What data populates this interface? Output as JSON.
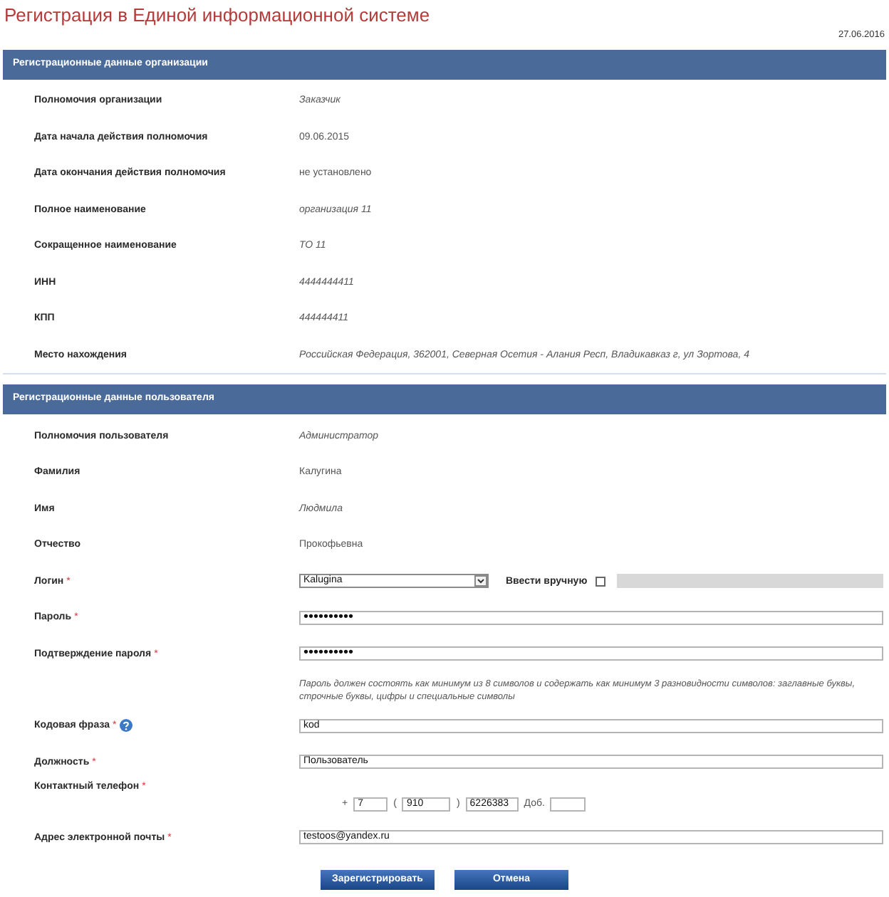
{
  "page": {
    "title": "Регистрация в Единой информационной системе",
    "date": "27.06.2016"
  },
  "sections": [
    {
      "title": "Регистрационные данные организации",
      "rows": [
        {
          "kind": "text",
          "label": "Полномочия организации",
          "value": "Заказчик",
          "italic": true
        },
        {
          "kind": "text",
          "label": "Дата начала действия полномочия",
          "value": "09.06.2015",
          "italic": false
        },
        {
          "kind": "text",
          "label": "Дата окончания действия полномочия",
          "value": "не установлено",
          "italic": false
        },
        {
          "kind": "text",
          "label": "Полное наименование",
          "value": "организация 11",
          "italic": true
        },
        {
          "kind": "text",
          "label": "Сокращенное наименование",
          "value": "ТО 11",
          "italic": true
        },
        {
          "kind": "text",
          "label": "ИНН",
          "value": "4444444411",
          "italic": true
        },
        {
          "kind": "text",
          "label": "КПП",
          "value": "444444411",
          "italic": true
        },
        {
          "kind": "text",
          "label": "Место нахождения",
          "value": "Российская Федерация, 362001, Северная Осетия - Алания Респ, Владикавказ г, ул Зортова, 4",
          "italic": true
        }
      ]
    },
    {
      "title": "Регистрационные данные пользователя",
      "rows": [
        {
          "kind": "text",
          "label": "Полномочия пользователя",
          "value": "Администратор",
          "italic": true
        },
        {
          "kind": "text",
          "label": "Фамилия",
          "value": "Калугина",
          "italic": false
        },
        {
          "kind": "text",
          "label": "Имя",
          "value": "Людмила",
          "italic": true
        },
        {
          "kind": "text",
          "label": "Отчество",
          "value": "Прокофьевна",
          "italic": false
        },
        {
          "kind": "login",
          "label": "Логин",
          "mark": "*",
          "value": "Kalugina",
          "manual_label": "Ввести вручную",
          "manual_checked": false
        },
        {
          "kind": "password",
          "label": "Пароль",
          "mark": "*",
          "value": "••••••••••"
        },
        {
          "kind": "password",
          "label": "Подтверждение пароля",
          "mark": "*",
          "value": "••••••••••"
        },
        {
          "kind": "hint",
          "text": "Пароль должен состоять как минимум из 8 символов и содержать как минимум 3 разновидности символов: заглавные буквы, строчные буквы, цифры и специальные символы"
        },
        {
          "kind": "input",
          "label": "Кодовая фраза",
          "mark": "*",
          "help": true,
          "value": "kod"
        },
        {
          "kind": "input",
          "label": "Должность",
          "mark": "*",
          "value": "Пользователь"
        },
        {
          "kind": "phone",
          "label": "Контактный телефон",
          "mark": "*",
          "parts": [
            {
              "kind": "sep",
              "text": "+"
            },
            {
              "kind": "field",
              "value": "7"
            },
            {
              "kind": "sep",
              "text": "("
            },
            {
              "kind": "field",
              "value": "910"
            },
            {
              "kind": "sep",
              "text": ")"
            },
            {
              "kind": "field",
              "value": "6226383"
            },
            {
              "kind": "sep",
              "text": "Доб."
            },
            {
              "kind": "field"
            }
          ]
        },
        {
          "kind": "input",
          "label": "Адрес электронной почты",
          "mark": "*",
          "value": "testoos@yandex.ru"
        }
      ]
    }
  ],
  "buttons": [
    {
      "label": "Зарегистрировать"
    },
    {
      "label": "Отмена"
    }
  ]
}
